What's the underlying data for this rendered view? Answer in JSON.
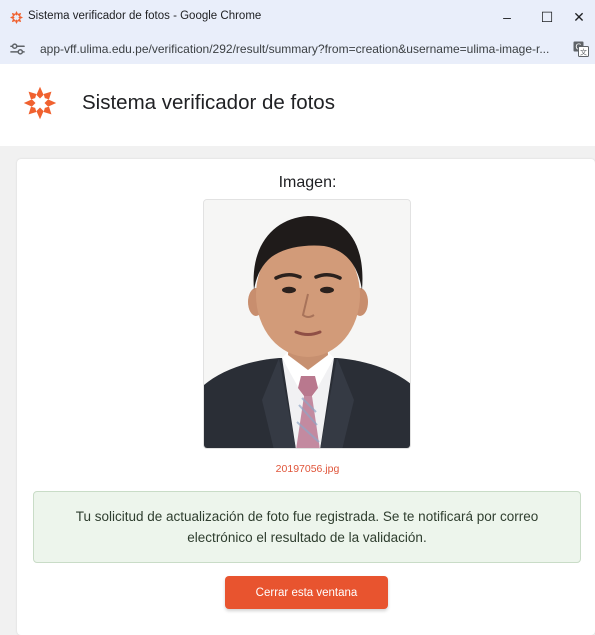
{
  "window": {
    "title": "Sistema verificador de fotos - Google Chrome",
    "controls": {
      "minimize": "–",
      "maximize": "☐",
      "close": "✕"
    }
  },
  "address_bar": {
    "url": "app-vff.ulima.edu.pe/verification/292/result/summary?from=creation&username=ulima-image-r..."
  },
  "header": {
    "title": "Sistema verificador de fotos",
    "logo_icon": "orange-star-logo-icon"
  },
  "main": {
    "image_heading": "Imagen:",
    "photo_icon": "person-portrait-photo",
    "filename": "20197056.jpg",
    "alert_message": "Tu solicitud de actualización de foto fue registrada. Se te notificará por correo electrónico el resultado de la validación.",
    "close_button_label": "Cerrar esta ventana"
  },
  "colors": {
    "accent": "#e8542f",
    "alert_bg": "#edf5ec",
    "alert_border": "#c9dcc7",
    "titlebar_bg": "#e9eefa"
  }
}
